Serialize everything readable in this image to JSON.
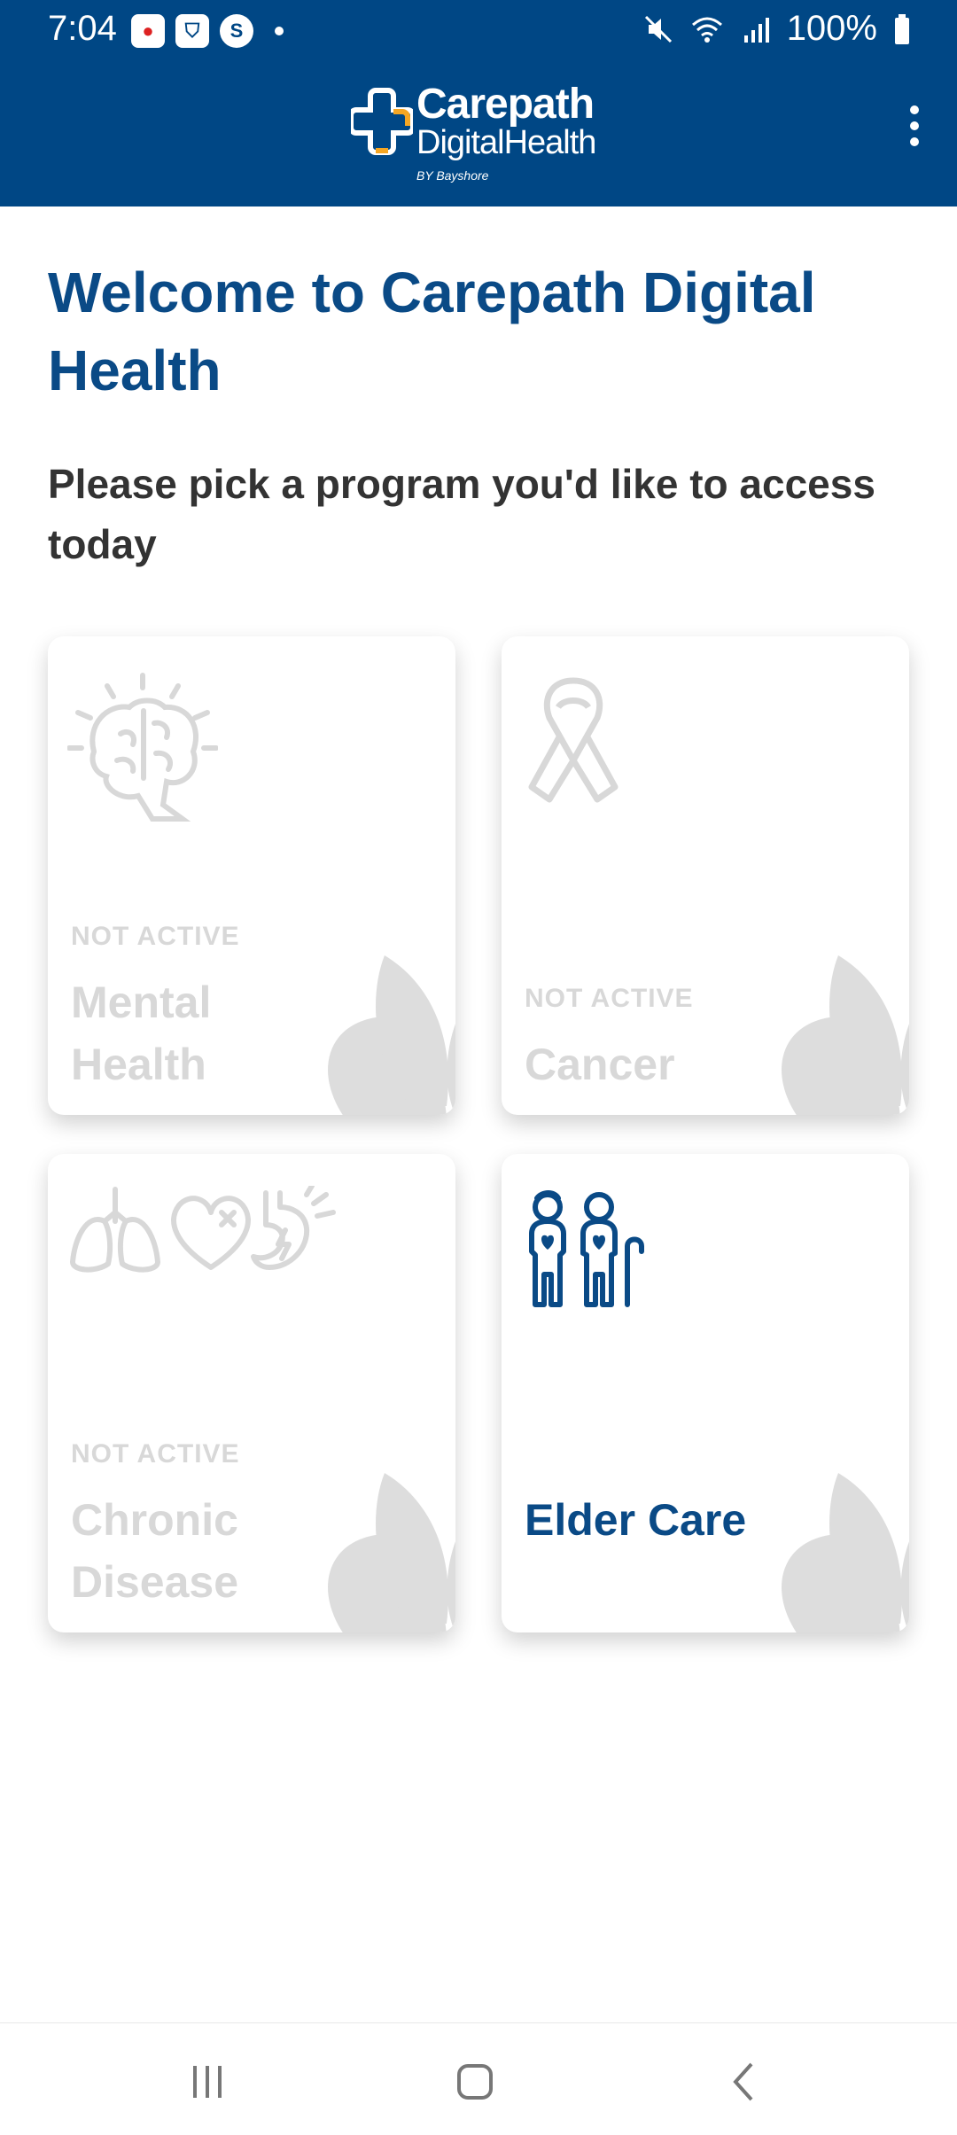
{
  "status": {
    "time": "7:04",
    "battery": "100%"
  },
  "app": {
    "logo_title": "Carepath",
    "logo_subtitle": "DigitalHealth",
    "logo_by": "BY Bayshore",
    "brand_color": "#004785"
  },
  "main": {
    "welcome": "Welcome to Carepath Digital Health",
    "subtitle": "Please pick a program you'd like to access today"
  },
  "programs": [
    {
      "status": "NOT ACTIVE",
      "title": "Mental Health",
      "active": false
    },
    {
      "status": "NOT ACTIVE",
      "title": "Cancer",
      "active": false
    },
    {
      "status": "NOT ACTIVE",
      "title": "Chronic Disease",
      "active": false
    },
    {
      "status": "",
      "title": "Elder Care",
      "active": true
    }
  ],
  "colors": {
    "active_text": "#0a4a86",
    "inactive_text": "#d8d8d8",
    "leaf": "#dddddd"
  },
  "icons": {
    "mental_health": "brain-icon",
    "cancer": "ribbon-icon",
    "chronic": "organs-icon",
    "elder": "elderly-couple-icon"
  }
}
